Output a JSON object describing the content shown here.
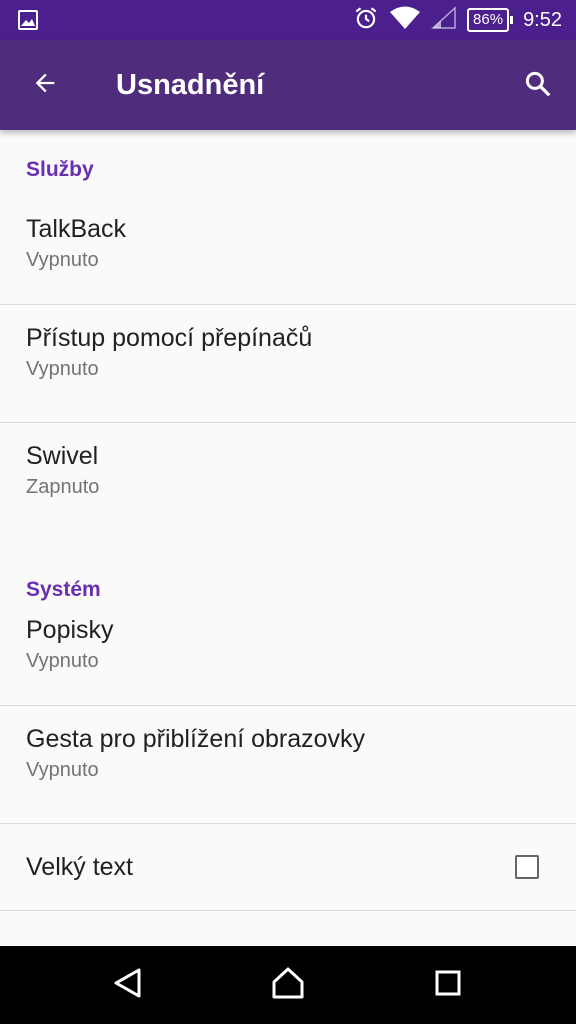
{
  "status_bar": {
    "battery": "86%",
    "time": "9:52"
  },
  "toolbar": {
    "title": "Usnadnění"
  },
  "sections": {
    "services_header": "Služby",
    "system_header": "Systém"
  },
  "items": {
    "talkback": {
      "title": "TalkBack",
      "summary": "Vypnuto"
    },
    "switch_access": {
      "title": "Přístup pomocí přepínačů",
      "summary": "Vypnuto"
    },
    "swivel": {
      "title": "Swivel",
      "summary": "Zapnuto"
    },
    "captions": {
      "title": "Popisky",
      "summary": "Vypnuto"
    },
    "magnification": {
      "title": "Gesta pro přiblížení obrazovky",
      "summary": "Vypnuto"
    },
    "large_text": {
      "title": "Velký text",
      "checked": false
    }
  },
  "colors": {
    "status_bar": "#4c1f8e",
    "toolbar": "#4f2d7c",
    "accent": "#6a2fb0",
    "background": "#fafafa"
  }
}
